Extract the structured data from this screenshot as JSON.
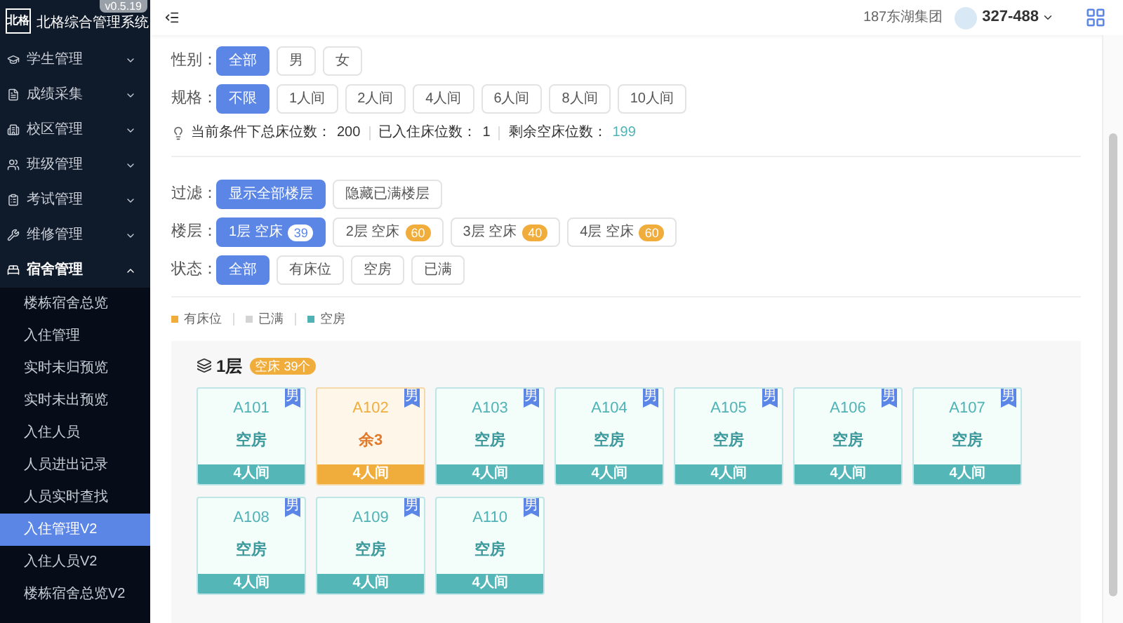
{
  "app": {
    "logo": "北格",
    "title": "北格综合管理系统",
    "version": "v0.5.19"
  },
  "sidebar": {
    "items": [
      {
        "label": "学生管理",
        "expanded": false
      },
      {
        "label": "成绩采集",
        "expanded": false
      },
      {
        "label": "校区管理",
        "expanded": false
      },
      {
        "label": "班级管理",
        "expanded": false
      },
      {
        "label": "考试管理",
        "expanded": false
      },
      {
        "label": "维修管理",
        "expanded": false
      },
      {
        "label": "宿舍管理",
        "expanded": true,
        "children": [
          {
            "label": "楼栋宿舍总览",
            "selected": false
          },
          {
            "label": "入住管理",
            "selected": false
          },
          {
            "label": "实时未归预览",
            "selected": false
          },
          {
            "label": "实时未出预览",
            "selected": false
          },
          {
            "label": "入住人员",
            "selected": false
          },
          {
            "label": "人员进出记录",
            "selected": false
          },
          {
            "label": "人员实时查找",
            "selected": false
          },
          {
            "label": "入住管理V2",
            "selected": true
          },
          {
            "label": "入住人员V2",
            "selected": false
          },
          {
            "label": "楼栋宿舍总览V2",
            "selected": false
          }
        ]
      }
    ]
  },
  "header": {
    "org": "187东湖集团",
    "user": "327-488"
  },
  "filters": [
    {
      "label": "性别：",
      "options": [
        {
          "label": "全部",
          "selected": true
        },
        {
          "label": "男",
          "selected": false
        },
        {
          "label": "女",
          "selected": false
        }
      ]
    },
    {
      "label": "规格：",
      "options": [
        {
          "label": "不限",
          "selected": true
        },
        {
          "label": "1人间",
          "selected": false
        },
        {
          "label": "2人间",
          "selected": false
        },
        {
          "label": "4人间",
          "selected": false
        },
        {
          "label": "6人间",
          "selected": false
        },
        {
          "label": "8人间",
          "selected": false
        },
        {
          "label": "10人间",
          "selected": false
        }
      ]
    }
  ],
  "stats": [
    {
      "label": "当前条件下总床位数：",
      "value": "200",
      "highlight": false
    },
    {
      "label": "已入住床位数：",
      "value": "1",
      "highlight": false
    },
    {
      "label": "剩余空床位数：",
      "value": "199",
      "highlight": true
    }
  ],
  "filters2": [
    {
      "label": "过滤：",
      "options": [
        {
          "label": "显示全部楼层",
          "selected": true
        },
        {
          "label": "隐藏已满楼层",
          "selected": false
        }
      ]
    },
    {
      "label": "楼层：",
      "options": [
        {
          "label": "1层 空床",
          "count": "39",
          "selected": true
        },
        {
          "label": "2层 空床",
          "count": "60",
          "selected": false
        },
        {
          "label": "3层 空床",
          "count": "40",
          "selected": false
        },
        {
          "label": "4层 空床",
          "count": "60",
          "selected": false
        }
      ]
    },
    {
      "label": "状态：",
      "options": [
        {
          "label": "全部",
          "selected": true
        },
        {
          "label": "有床位",
          "selected": false
        },
        {
          "label": "空房",
          "selected": false
        },
        {
          "label": "已满",
          "selected": false
        }
      ]
    }
  ],
  "legend": [
    {
      "label": "有床位",
      "color": "#f0ad3c"
    },
    {
      "label": "已满",
      "color": "#d4d4d4"
    },
    {
      "label": "空房",
      "color": "#4fb3b6"
    }
  ],
  "floor": {
    "title": "1层",
    "badge": "空床 39个",
    "rooms": [
      {
        "code": "A101",
        "status": "空房",
        "type": "4人间",
        "gender": "男",
        "kind": "empty"
      },
      {
        "code": "A102",
        "status": "余3",
        "type": "4人间",
        "gender": "男",
        "kind": "available"
      },
      {
        "code": "A103",
        "status": "空房",
        "type": "4人间",
        "gender": "男",
        "kind": "empty"
      },
      {
        "code": "A104",
        "status": "空房",
        "type": "4人间",
        "gender": "男",
        "kind": "empty"
      },
      {
        "code": "A105",
        "status": "空房",
        "type": "4人间",
        "gender": "男",
        "kind": "empty"
      },
      {
        "code": "A106",
        "status": "空房",
        "type": "4人间",
        "gender": "男",
        "kind": "empty"
      },
      {
        "code": "A107",
        "status": "空房",
        "type": "4人间",
        "gender": "男",
        "kind": "empty"
      },
      {
        "code": "A108",
        "status": "空房",
        "type": "4人间",
        "gender": "男",
        "kind": "empty"
      },
      {
        "code": "A109",
        "status": "空房",
        "type": "4人间",
        "gender": "男",
        "kind": "empty"
      },
      {
        "code": "A110",
        "status": "空房",
        "type": "4人间",
        "gender": "男",
        "kind": "empty"
      }
    ]
  }
}
